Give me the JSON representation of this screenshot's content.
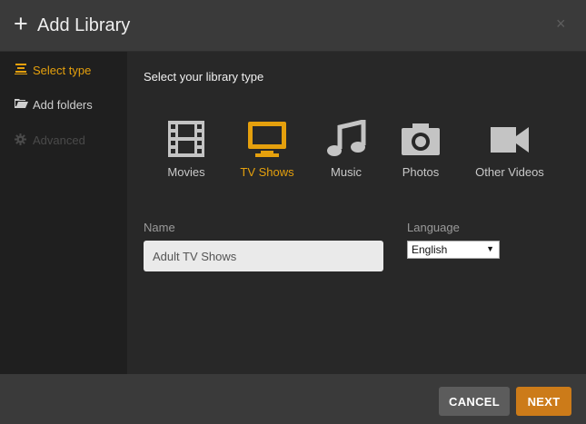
{
  "dialog": {
    "title": "Add Library",
    "plus_glyph": "+",
    "close_glyph": "×"
  },
  "sidebar": {
    "items": [
      {
        "label": "Select type",
        "icon": "list-icon",
        "state": "active"
      },
      {
        "label": "Add folders",
        "icon": "folder-icon",
        "state": "normal"
      },
      {
        "label": "Advanced",
        "icon": "gear-icon",
        "state": "disabled"
      }
    ]
  },
  "main": {
    "section_title": "Select your library type",
    "types": [
      {
        "label": "Movies",
        "icon": "film-icon",
        "selected": false
      },
      {
        "label": "TV Shows",
        "icon": "tv-icon",
        "selected": true
      },
      {
        "label": "Music",
        "icon": "music-note-icon",
        "selected": false
      },
      {
        "label": "Photos",
        "icon": "camera-icon",
        "selected": false
      },
      {
        "label": "Other Videos",
        "icon": "video-camera-icon",
        "selected": false
      }
    ],
    "name_label": "Name",
    "name_value": "Adult TV Shows",
    "language_label": "Language",
    "language_value": "English",
    "language_arrow": "▼"
  },
  "footer": {
    "cancel_label": "CANCEL",
    "next_label": "NEXT"
  },
  "colors": {
    "accent": "#e5a00d",
    "next_button": "#cc7b19",
    "cancel_button": "#5c5c5c",
    "sidebar_bg": "#1f1f1f",
    "main_bg": "#282828",
    "header_bg": "#3a3a3a"
  }
}
